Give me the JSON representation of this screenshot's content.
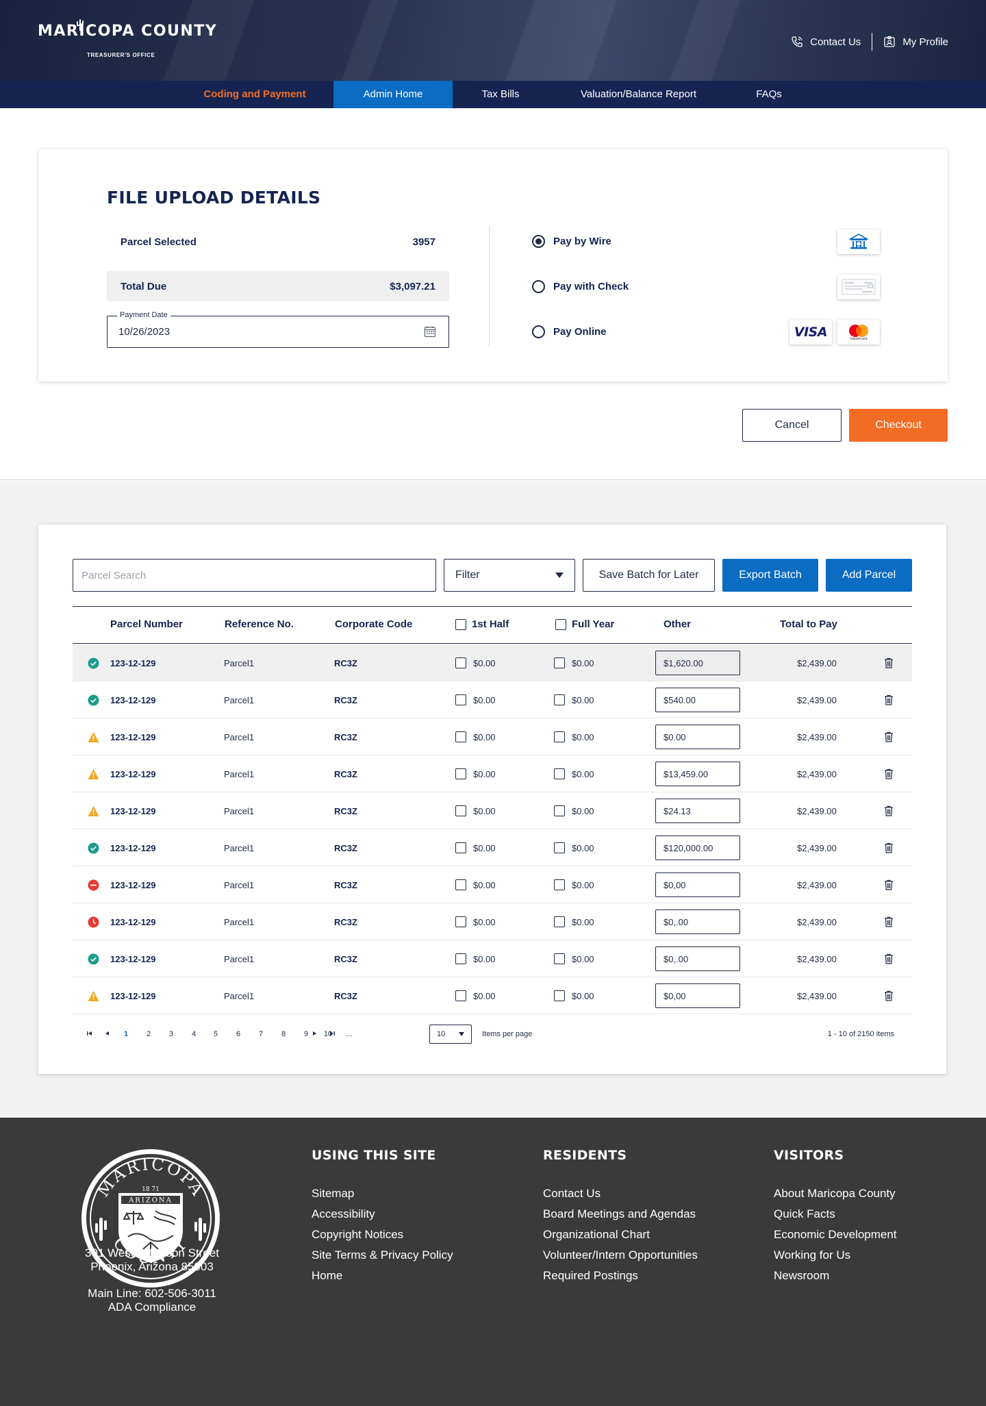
{
  "header": {
    "logo_name": "MARICOPA COUNTY",
    "logo_sub": "TREASURER'S OFFICE",
    "contact_label": "Contact Us",
    "profile_label": "My Profile"
  },
  "nav": [
    {
      "label": "Coding and Payment"
    },
    {
      "label": "Admin Home"
    },
    {
      "label": "Tax Bills"
    },
    {
      "label": "Valuation/Balance Report"
    },
    {
      "label": "FAQs"
    }
  ],
  "upload": {
    "title": "FILE UPLOAD DETAILS",
    "parcel_selected_label": "Parcel Selected",
    "parcel_selected_value": "3957",
    "total_due_label": "Total Due",
    "total_due_value": "$3,097.21",
    "payment_date_label": "Payment Date",
    "payment_date_value": "10/26/2023",
    "pay_options": [
      {
        "label": "Pay by Wire",
        "selected": true
      },
      {
        "label": "Pay with Check",
        "selected": false
      },
      {
        "label": "Pay Online",
        "selected": false
      }
    ],
    "visa_label": "VISA",
    "mastercard_label": "mastercard"
  },
  "actions": {
    "cancel_label": "Cancel",
    "checkout_label": "Checkout"
  },
  "toolbar": {
    "search_placeholder": "Parcel Search",
    "filter_label": "Filter",
    "save_batch_label": "Save Batch for Later",
    "export_batch_label": "Export Batch",
    "add_parcel_label": "Add Parcel"
  },
  "table": {
    "headers": {
      "parcel_number": "Parcel Number",
      "reference_no": "Reference No.",
      "corporate_code": "Corporate Code",
      "first_half": "1st Half",
      "full_year": "Full Year",
      "other": "Other",
      "total_to_pay": "Total  to Pay"
    },
    "rows": [
      {
        "status": "ok",
        "parcel": "123-12-129",
        "ref": "Parcel1",
        "code": "RC3Z",
        "first_half": "$0.00",
        "full_year": "$0.00",
        "other": "$1,620.00",
        "total": "$2,439.00"
      },
      {
        "status": "ok",
        "parcel": "123-12-129",
        "ref": "Parcel1",
        "code": "RC3Z",
        "first_half": "$0.00",
        "full_year": "$0.00",
        "other": "$540.00",
        "total": "$2,439.00"
      },
      {
        "status": "warning",
        "parcel": "123-12-129",
        "ref": "Parcel1",
        "code": "RC3Z",
        "first_half": "$0.00",
        "full_year": "$0.00",
        "other": "$0.00",
        "total": "$2,439.00"
      },
      {
        "status": "warning",
        "parcel": "123-12-129",
        "ref": "Parcel1",
        "code": "RC3Z",
        "first_half": "$0.00",
        "full_year": "$0.00",
        "other": "$13,459.00",
        "total": "$2,439.00"
      },
      {
        "status": "warning",
        "parcel": "123-12-129",
        "ref": "Parcel1",
        "code": "RC3Z",
        "first_half": "$0.00",
        "full_year": "$0.00",
        "other": "$24.13",
        "total": "$2,439.00"
      },
      {
        "status": "ok",
        "parcel": "123-12-129",
        "ref": "Parcel1",
        "code": "RC3Z",
        "first_half": "$0.00",
        "full_year": "$0.00",
        "other": "$120,000.00",
        "total": "$2,439.00"
      },
      {
        "status": "blocked",
        "parcel": "123-12-129",
        "ref": "Parcel1",
        "code": "RC3Z",
        "first_half": "$0.00",
        "full_year": "$0.00",
        "other": "$0,00",
        "total": "$2,439.00"
      },
      {
        "status": "error",
        "parcel": "123-12-129",
        "ref": "Parcel1",
        "code": "RC3Z",
        "first_half": "$0.00",
        "full_year": "$0.00",
        "other": "$0,.00",
        "total": "$2,439.00"
      },
      {
        "status": "ok",
        "parcel": "123-12-129",
        "ref": "Parcel1",
        "code": "RC3Z",
        "first_half": "$0.00",
        "full_year": "$0.00",
        "other": "$0,.00",
        "total": "$2,439.00"
      },
      {
        "status": "warning",
        "parcel": "123-12-129",
        "ref": "Parcel1",
        "code": "RC3Z",
        "first_half": "$0.00",
        "full_year": "$0.00",
        "other": "$0,00",
        "total": "$2,439.00"
      }
    ]
  },
  "pagination": {
    "pages": [
      "1",
      "2",
      "3",
      "4",
      "5",
      "6",
      "7",
      "8",
      "9",
      "10",
      "..."
    ],
    "current": "1",
    "per_page": "10",
    "per_page_label": "Items per page",
    "summary": "1 - 10 of 2150 items"
  },
  "footer": {
    "address_line1": "301 West Jefferson Street",
    "address_line2": "Phoenix, Arizona 85003",
    "main_line": "Main Line:  602-506-3011",
    "ada": "ADA Compliance",
    "seal_top": "MARICOPA",
    "seal_state": "ARIZONA",
    "seal_bottom": "COUNTY",
    "seal_year": "18 71",
    "columns": [
      {
        "heading": "USING THIS SITE",
        "links": [
          "Sitemap",
          "Accessibility",
          "Copyright Notices",
          "Site Terms & Privacy Policy",
          "Home"
        ]
      },
      {
        "heading": "RESIDENTS",
        "links": [
          "Contact Us",
          "Board Meetings and Agendas",
          "Organizational Chart",
          "Volunteer/Intern Opportunities",
          "Required Postings"
        ]
      },
      {
        "heading": "VISITORS",
        "links": [
          "About Maricopa County",
          "Quick Facts",
          "Economic Development",
          "Working for Us",
          "Newsroom"
        ]
      }
    ]
  },
  "colors": {
    "navy": "#152451",
    "accent_orange": "#f36c23",
    "accent_blue": "#0a6cc2",
    "status_ok": "#1e9c8a",
    "status_warning": "#f4a623",
    "status_error": "#e53935",
    "footer_bg": "#3a3a3a"
  },
  "icons": {
    "status_ok": "check-circle-icon",
    "status_warning": "warning-triangle-icon",
    "status_blocked": "minus-circle-icon",
    "status_error": "clock-alert-icon",
    "delete": "trash-icon"
  }
}
